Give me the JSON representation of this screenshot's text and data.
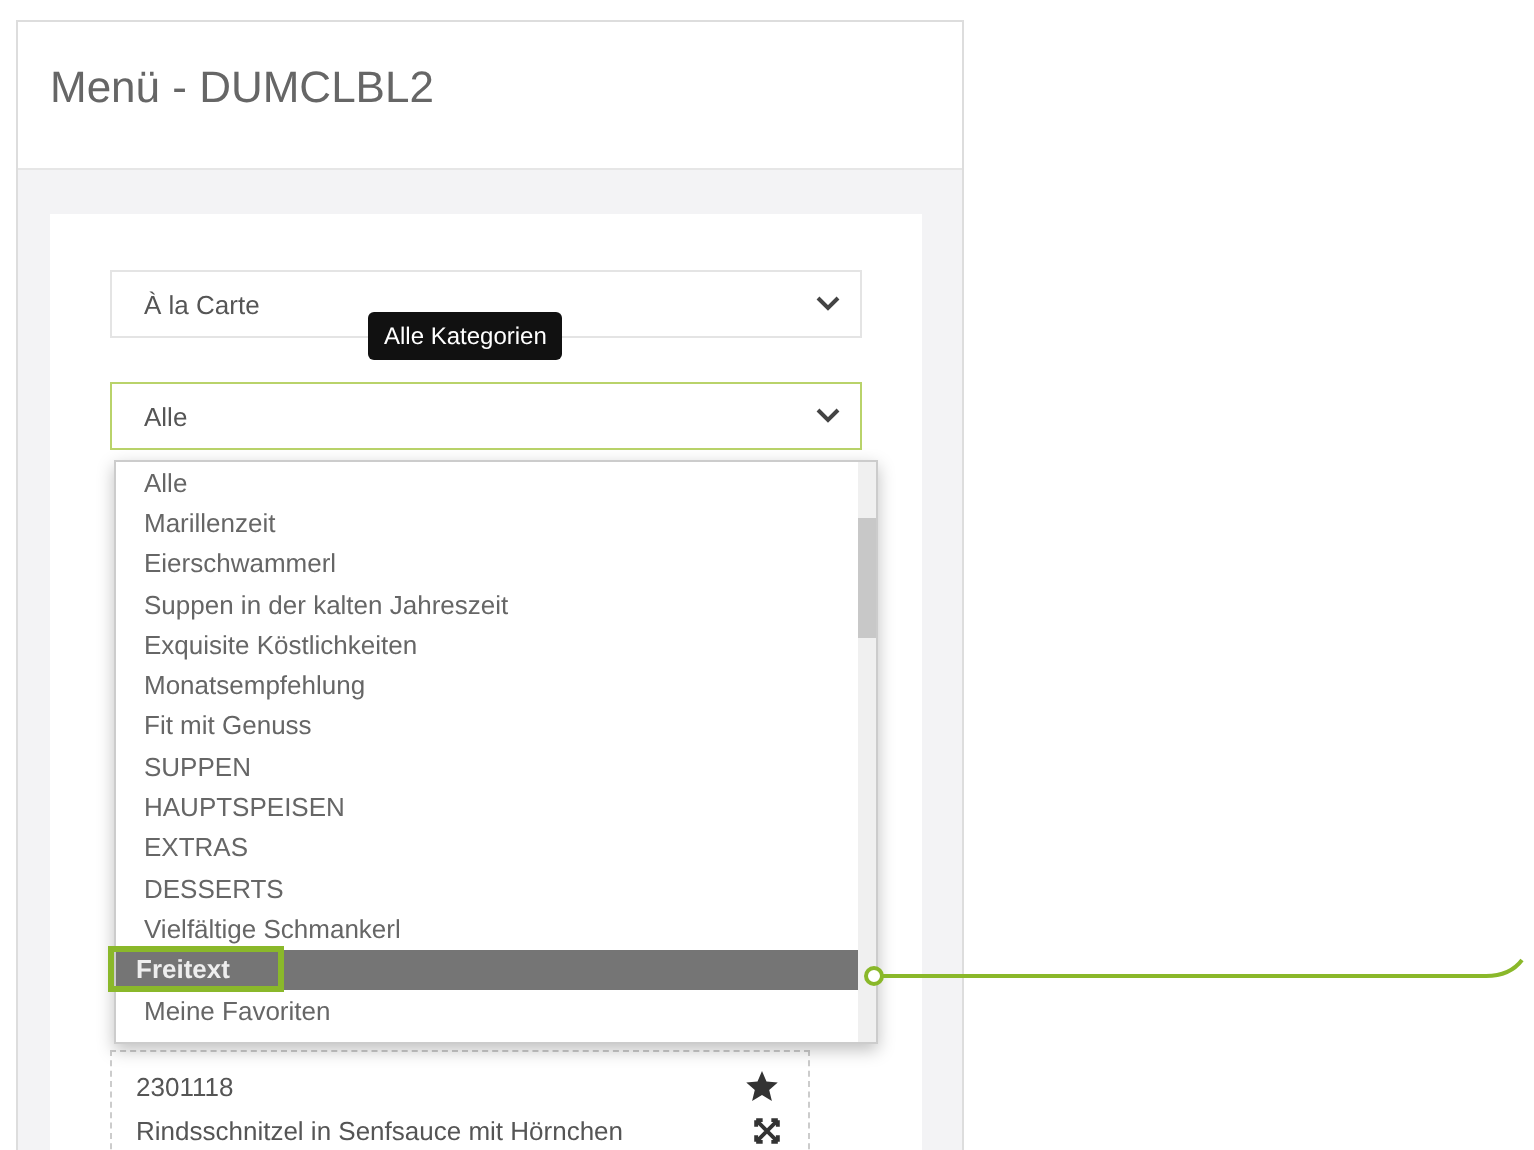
{
  "window": {
    "title": "Menü - DUMCLBL2"
  },
  "selects": [
    {
      "value": "À la Carte",
      "focused": false
    },
    {
      "value": "Alle",
      "focused": true
    }
  ],
  "tooltip": "Alle Kategorien",
  "dropdown": {
    "options": [
      {
        "label": "Alle",
        "selected": false
      },
      {
        "label": "Marillenzeit",
        "selected": false
      },
      {
        "label": "Eierschwammerl",
        "selected": false
      },
      {
        "label": "Suppen in der kalten Jahreszeit",
        "selected": false
      },
      {
        "label": "Exquisite Köstlichkeiten",
        "selected": false
      },
      {
        "label": "Monatsempfehlung",
        "selected": false
      },
      {
        "label": "Fit mit Genuss",
        "selected": false
      },
      {
        "label": "SUPPEN",
        "selected": false
      },
      {
        "label": "HAUPTSPEISEN",
        "selected": false
      },
      {
        "label": "EXTRAS",
        "selected": false
      },
      {
        "label": "DESSERTS",
        "selected": false
      },
      {
        "label": "Vielfältige Schmankerl",
        "selected": false
      },
      {
        "label": "Freitext",
        "selected": true
      },
      {
        "label": "Meine Favoriten",
        "selected": false
      }
    ]
  },
  "menu_item": {
    "number": "2301118",
    "name": "Rindsschnitzel in Senfsauce mit Hörnchen"
  }
}
